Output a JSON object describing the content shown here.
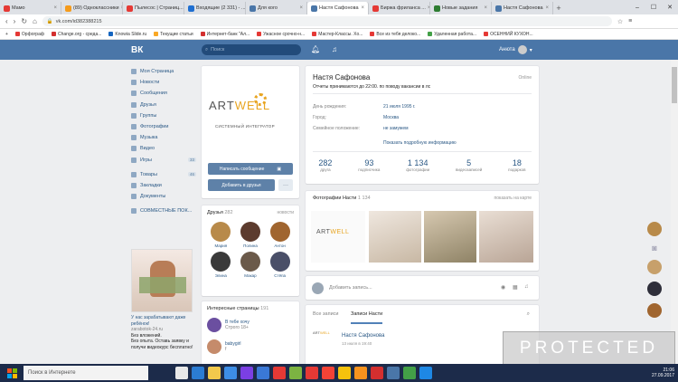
{
  "browser": {
    "tabs": [
      {
        "label": "Мамо",
        "color": "#e53935"
      },
      {
        "label": "(89) Одноклассники",
        "color": "#f59b1b"
      },
      {
        "label": "Пылесос | Страниц...",
        "color": "#e53935"
      },
      {
        "label": "Входящие (2 331) - ...",
        "color": "#1f6fd1"
      },
      {
        "label": "Для кого",
        "color": "#4a76a8"
      },
      {
        "label": "Настя Сафонова",
        "color": "#4a76a8",
        "active": true
      },
      {
        "label": "Биржа фриланса ...",
        "color": "#e53935"
      },
      {
        "label": "Новые задания",
        "color": "#2e7d32"
      },
      {
        "label": "Настя Сафонова",
        "color": "#4a76a8"
      }
    ],
    "url": "vk.com/id382388215",
    "bookmarks": [
      {
        "label": "Орфограф",
        "color": "#e53935"
      },
      {
        "label": "Chаnge.org - среда...",
        "color": "#d32f2f"
      },
      {
        "label": "Knowia Slide.ru",
        "color": "#1565c0"
      },
      {
        "label": "Текущие статьи",
        "color": "#f9a825"
      },
      {
        "label": "Интернет-банк \"Ал...",
        "color": "#d32f2f"
      },
      {
        "label": "Ужасное срочно-н...",
        "color": "#e53935"
      },
      {
        "label": "Мастер-Классы. Хо...",
        "color": "#e53935"
      },
      {
        "label": "Все из тебя делоко...",
        "color": "#e53935"
      },
      {
        "label": "Удаленная работа...",
        "color": "#43a047"
      },
      {
        "label": "ОСЕННИЙ КУХОН...",
        "color": "#e53935"
      }
    ]
  },
  "header": {
    "logo": "ВК",
    "search_placeholder": "Поиск",
    "user_name": "Анюта"
  },
  "leftnav": {
    "items": [
      {
        "label": "Моя Страница"
      },
      {
        "label": "Новости"
      },
      {
        "label": "Сообщения"
      },
      {
        "label": "Друзья"
      },
      {
        "label": "Группы"
      },
      {
        "label": "Фотографии"
      },
      {
        "label": "Музыка"
      },
      {
        "label": "Видео"
      },
      {
        "label": "Игры",
        "count": "33"
      },
      {
        "label": "Товары",
        "count": "46",
        "sep": true
      },
      {
        "label": "Закладки"
      },
      {
        "label": "Документы"
      },
      {
        "label": "СОВМЕСТНЫЕ ПОК...",
        "sep": true
      }
    ]
  },
  "ad": {
    "title": "У нас зарабатывают даже ребёнок!",
    "domain": "zarabotok-24.ru",
    "text1": "Без вложений.",
    "text2": "Без опыта. Оставь заявку и получи видеокурс бесплатно!"
  },
  "avatar_card": {
    "brand_left": "ART",
    "brand_right": "WELL",
    "tagline": "СИСТЕМНЫЙ ИНТЕГРАТОР",
    "message_btn": "Написать сообщение",
    "add_friend_btn": "Добавить в друзья",
    "more_btn": "···"
  },
  "friends": {
    "title": "Друзья",
    "count": "282",
    "new_label": "новости",
    "list": [
      {
        "name": "Мария",
        "color": "#b88a4a"
      },
      {
        "name": "Полина",
        "color": "#5c3b2e"
      },
      {
        "name": "Антон",
        "color": "#a0652f"
      },
      {
        "name": "Элина",
        "color": "#3a3a3a"
      },
      {
        "name": "Макар",
        "color": "#6b5a4a"
      },
      {
        "name": "Стёпа",
        "color": "#4a4f68"
      }
    ]
  },
  "pages": {
    "title": "Интересные страницы",
    "count": "191",
    "items": [
      {
        "name": "В тебе хочу",
        "sub": "Строго 18+",
        "color": "#6b4fa0"
      },
      {
        "name": "babygirl",
        "sub": "f",
        "color": "#c58b6b"
      }
    ]
  },
  "profile": {
    "name": "Настя Сафонова",
    "status": "Отчеты принимаются до 22:00. по поводу вакансии в лс",
    "online": "Online",
    "fields": [
      {
        "key": "День рождения:",
        "value": "21 июля 1995 г."
      },
      {
        "key": "Город:",
        "value": "Москва"
      },
      {
        "key": "Семейное положение:",
        "value": "не замужем"
      }
    ],
    "more": "Показать подробную информацию",
    "stats": [
      {
        "n": "282",
        "l": "друга"
      },
      {
        "n": "93",
        "l": "подписчика"
      },
      {
        "n": "1 134",
        "l": "фотографии"
      },
      {
        "n": "5",
        "l": "видеозаписей"
      },
      {
        "n": "18",
        "l": "подарков"
      }
    ]
  },
  "photos": {
    "title": "Фотографии Насти",
    "count": "1 134",
    "map": "показать на карте"
  },
  "composer": {
    "placeholder": "Добавить запись..."
  },
  "wall": {
    "tab_all": "Все записи",
    "tab_owner": "Записи Насти",
    "post_author": "Настя Сафонова",
    "post_date": "13 июля в 19:40"
  },
  "taskbar": {
    "search_placeholder": "Поиск в Интернете",
    "time": "21:06",
    "date": "27.09.2017"
  },
  "watermark": "PROTECTED"
}
